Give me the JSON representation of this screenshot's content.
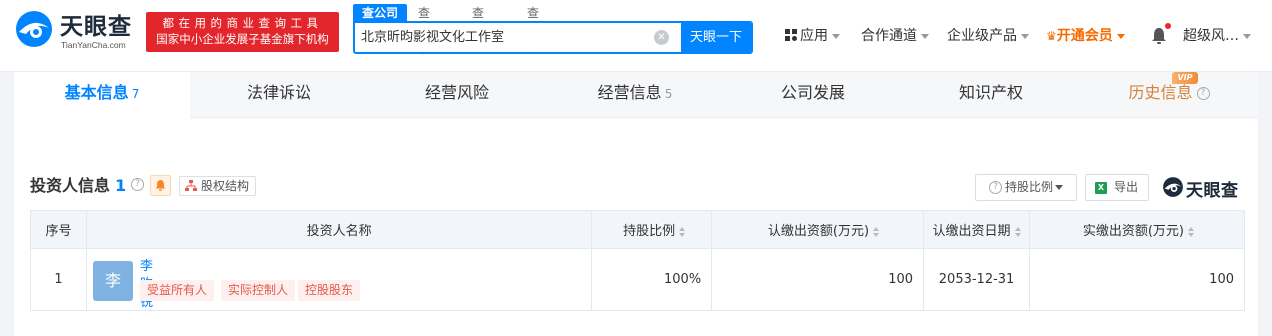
{
  "header": {
    "logo_cn": "天眼查",
    "logo_en": "TianYanCha.com",
    "slogan_line1": "都在用的商业查询工具",
    "slogan_line2": "国家中小企业发展子基金旗下机构",
    "search_tabs": [
      "查公司",
      "查老板",
      "查关系",
      "查风险"
    ],
    "search_value": "北京昕昀影视文化工作室",
    "search_button": "天眼一下",
    "nav": {
      "apps": "应用",
      "cooperation": "合作通道",
      "enterprise": "企业级产品",
      "vip": "开通会员",
      "user": "超级风…"
    }
  },
  "tabs": [
    {
      "label": "基本信息",
      "count": "7"
    },
    {
      "label": "法律诉讼",
      "count": ""
    },
    {
      "label": "经营风险",
      "count": ""
    },
    {
      "label": "经营信息",
      "count": "5"
    },
    {
      "label": "公司发展",
      "count": ""
    },
    {
      "label": "知识产权",
      "count": ""
    },
    {
      "label": "历史信息",
      "count": ""
    }
  ],
  "vip_badge": "VIP",
  "section": {
    "title": "投资人信息",
    "count": "1",
    "equity_button": "股权结构",
    "ratio_button": "持股比例",
    "export_button": "导出",
    "watermark": "天眼查"
  },
  "table": {
    "headers": [
      "序号",
      "投资人名称",
      "持股比例",
      "认缴出资额(万元)",
      "认缴出资日期",
      "实缴出资额(万元)"
    ],
    "rows": [
      {
        "index": "1",
        "avatar": "李",
        "name": "李昀锐",
        "tags": [
          "受益所有人",
          "实际控制人",
          "控股股东"
        ],
        "ratio": "100%",
        "subscribed": "100",
        "date": "2053-12-31",
        "paid": "100"
      }
    ]
  }
}
